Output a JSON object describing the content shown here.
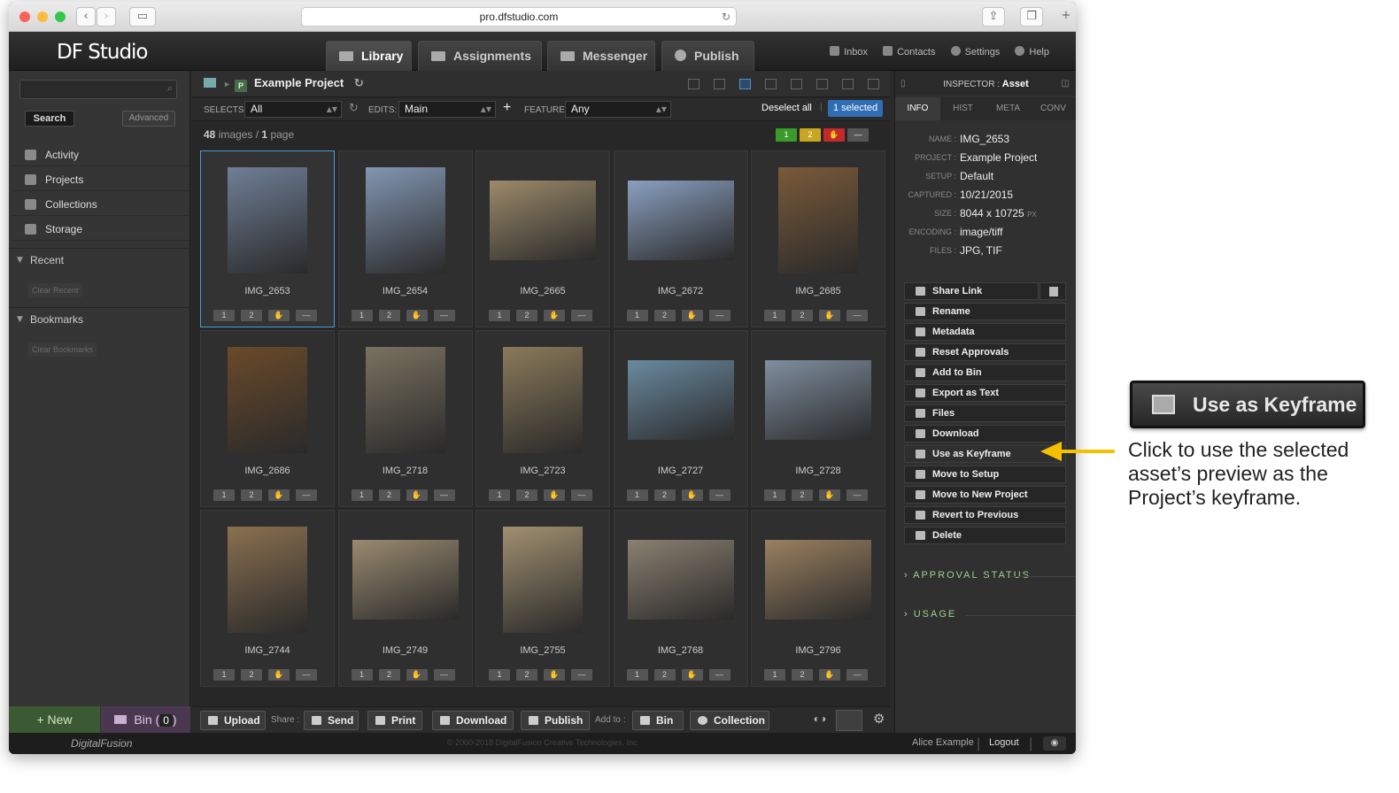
{
  "browser": {
    "url": "pro.dfstudio.com"
  },
  "app": {
    "logo": "DF Studio",
    "tabs": [
      {
        "label": "Library"
      },
      {
        "label": "Assignments"
      },
      {
        "label": "Messenger"
      },
      {
        "label": "Publish"
      }
    ],
    "toplinks": [
      "Inbox",
      "Contacts",
      "Settings",
      "Help"
    ]
  },
  "sidebar": {
    "search_button": "Search",
    "advanced_button": "Advanced",
    "items": [
      {
        "label": "Activity",
        "icon": "activity-icon"
      },
      {
        "label": "Projects",
        "icon": "projects-icon"
      },
      {
        "label": "Collections",
        "icon": "collections-icon"
      },
      {
        "label": "Storage",
        "icon": "storage-icon"
      }
    ],
    "recent": "Recent",
    "clear_recent": "Clear Recent",
    "bookmarks": "Bookmarks",
    "clear_bookmarks": "Clear Bookmarks",
    "new_button": "+ New",
    "bin_label": "Bin",
    "bin_count": "0"
  },
  "main": {
    "breadcrumb_badge": "P",
    "project_title": "Example Project",
    "selects_label": "SELECTS:",
    "selects_value": "All",
    "edits_label": "EDITS:",
    "edits_value": "Main",
    "feature_label": "FEATURE:",
    "feature_value": "Any",
    "deselect_all": "Deselect all",
    "selected_count": "1 selected",
    "image_count": "48",
    "images_word": "images /",
    "page_count": "1",
    "page_word": "page",
    "rating_labels": [
      "1",
      "2",
      "✋",
      "—"
    ],
    "flag_colors": [
      "#3a9a2a",
      "#c9a621",
      "#c42a2a",
      "#555555"
    ],
    "images": [
      {
        "name": "IMG_2653",
        "orient": "p",
        "color": "#6f7f97",
        "selected": true
      },
      {
        "name": "IMG_2654",
        "orient": "p",
        "color": "#8296b2"
      },
      {
        "name": "IMG_2665",
        "orient": "l",
        "color": "#9c8a6a"
      },
      {
        "name": "IMG_2672",
        "orient": "l",
        "color": "#8aa0c0"
      },
      {
        "name": "IMG_2685",
        "orient": "p",
        "color": "#7a5a3a"
      },
      {
        "name": "IMG_2686",
        "orient": "p",
        "color": "#6a4a2a"
      },
      {
        "name": "IMG_2718",
        "orient": "p",
        "color": "#7a7260"
      },
      {
        "name": "IMG_2723",
        "orient": "p",
        "color": "#8a7a5a"
      },
      {
        "name": "IMG_2727",
        "orient": "l",
        "color": "#6a8aa0"
      },
      {
        "name": "IMG_2728",
        "orient": "l",
        "color": "#7f8f9f"
      },
      {
        "name": "IMG_2744",
        "orient": "p",
        "color": "#8a7050"
      },
      {
        "name": "IMG_2749",
        "orient": "l",
        "color": "#9a8a70"
      },
      {
        "name": "IMG_2755",
        "orient": "p",
        "color": "#a09070"
      },
      {
        "name": "IMG_2768",
        "orient": "l",
        "color": "#8a8070"
      },
      {
        "name": "IMG_2796",
        "orient": "l",
        "color": "#9a8060"
      }
    ],
    "bottom": {
      "upload": "Upload",
      "share_label": "Share :",
      "send": "Send",
      "print": "Print",
      "download": "Download",
      "publish": "Publish",
      "addto_label": "Add to :",
      "bin": "Bin",
      "collection": "Collection"
    }
  },
  "inspector": {
    "title_prefix": "INSPECTOR :",
    "title": "Asset",
    "tabs": [
      "INFO",
      "HIST",
      "META",
      "CONV"
    ],
    "fields": [
      {
        "key": "NAME :",
        "value": "IMG_2653"
      },
      {
        "key": "PROJECT :",
        "value": "Example Project"
      },
      {
        "key": "SETUP :",
        "value": "Default"
      },
      {
        "key": "CAPTURED :",
        "value": "10/21/2015"
      },
      {
        "key": "SIZE :",
        "value": "8044 x 10725",
        "unit": "PX"
      },
      {
        "key": "ENCODING :",
        "value": "image/tiff"
      },
      {
        "key": "FILES :",
        "value": "JPG, TIF"
      }
    ],
    "actions": [
      {
        "label": "Share Link",
        "icon": "link-icon"
      },
      {
        "label": "Rename",
        "icon": "rename-icon"
      },
      {
        "label": "Metadata",
        "icon": "metadata-icon"
      },
      {
        "label": "Reset Approvals",
        "icon": "reset-icon"
      },
      {
        "label": "Add to Bin",
        "icon": "bin-icon"
      },
      {
        "label": "Export as Text",
        "icon": "export-icon"
      },
      {
        "label": "Files",
        "icon": "files-icon"
      },
      {
        "label": "Download",
        "icon": "download-icon"
      },
      {
        "label": "Use as Keyframe",
        "icon": "keyframe-icon"
      },
      {
        "label": "Move to Setup",
        "icon": "arrow-right-icon"
      },
      {
        "label": "Move to New Project",
        "icon": "arrow-right-icon"
      },
      {
        "label": "Revert to Previous",
        "icon": "revert-icon"
      },
      {
        "label": "Delete",
        "icon": "trash-icon"
      }
    ],
    "approval_status": "APPROVAL STATUS",
    "usage": "USAGE"
  },
  "footer": {
    "brand": "DigitalFusion",
    "copyright": "© 2000-2018 DigitalFusion Creative Technologies, Inc.",
    "user": "Alice Example",
    "logout": "Logout"
  },
  "callout": {
    "button_label": "Use as Keyframe",
    "text": "Click to use the selected asset’s preview as the Project’s keyframe.",
    "arrow_color": "#f5c000"
  }
}
